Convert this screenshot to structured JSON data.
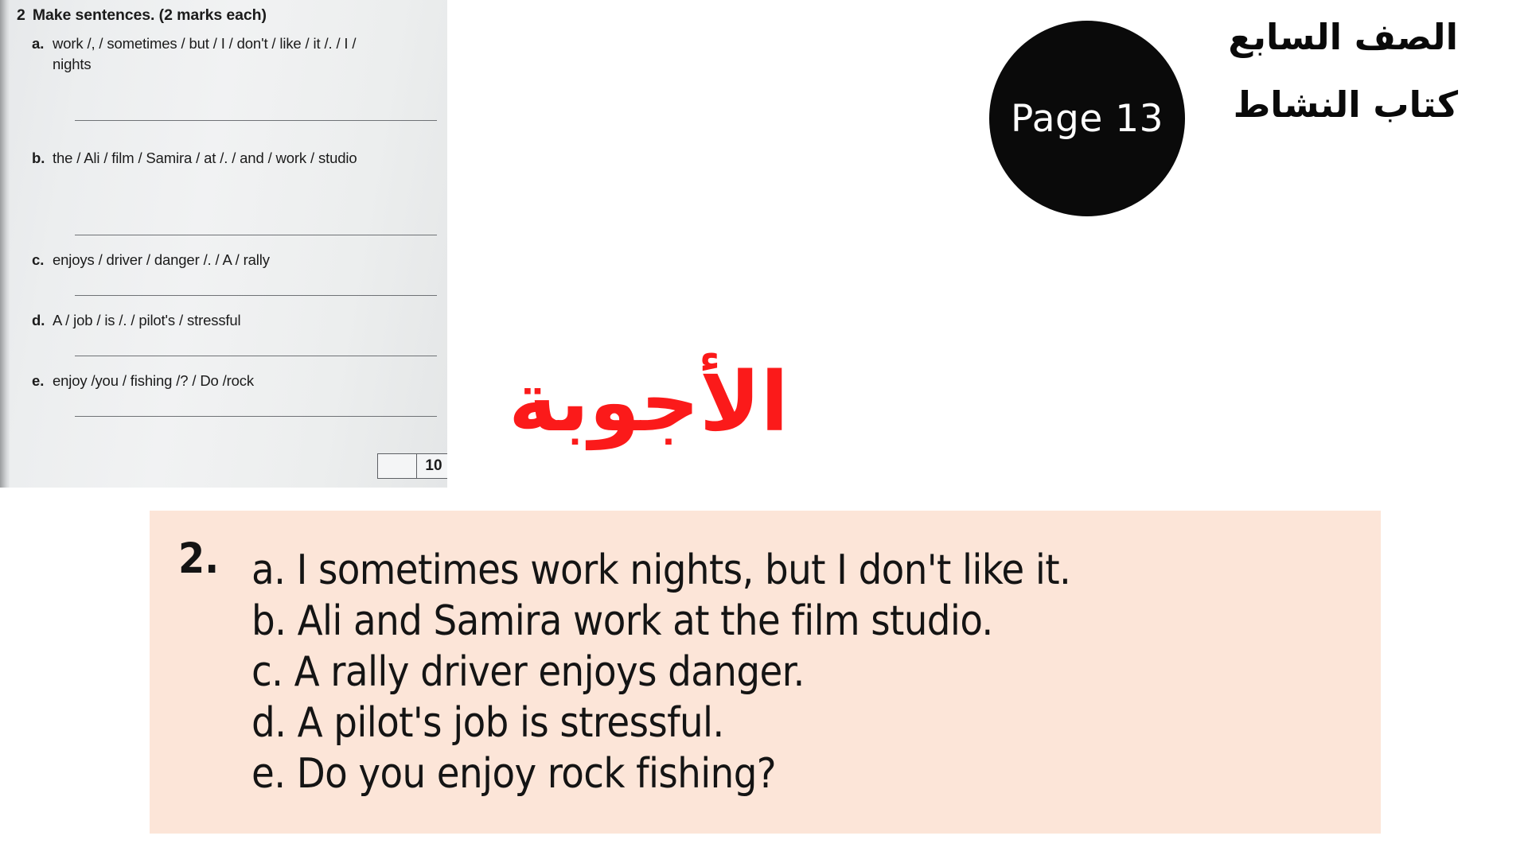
{
  "worksheet": {
    "exercise_number": "2",
    "exercise_title": "Make sentences. (2 marks each)",
    "questions": [
      {
        "letter": "a.",
        "prompt": "work /, / sometimes / but / I / don't / like / it /. / I / nights"
      },
      {
        "letter": "b.",
        "prompt": "the / Ali / film / Samira / at /. / and / work / studio"
      },
      {
        "letter": "c.",
        "prompt": "enjoys / driver / danger /. / A / rally"
      },
      {
        "letter": "d.",
        "prompt": "A / job / is /. / pilot's / stressful"
      },
      {
        "letter": "e.",
        "prompt": "enjoy /you / fishing /? / Do /rock"
      }
    ],
    "score_box": {
      "blank": "",
      "total": "10"
    }
  },
  "page_badge": {
    "label": "Page 13"
  },
  "header": {
    "grade": "الصف السابع",
    "book": "كتاب النشاط"
  },
  "answers_title": "الأجوبة",
  "answer_box": {
    "number": "2.",
    "lines": [
      "a. I sometimes work nights, but I don't like it.",
      "b. Ali and Samira work at the film studio.",
      "c. A rally driver enjoys danger.",
      "d. A pilot's job is stressful.",
      "e. Do you enjoy rock fishing?"
    ]
  },
  "colors": {
    "title_red": "#fb1a1a",
    "answer_box_bg": "#fce5d8",
    "badge_bg": "#0a0a0a",
    "worksheet_bg": "#eceeef"
  }
}
